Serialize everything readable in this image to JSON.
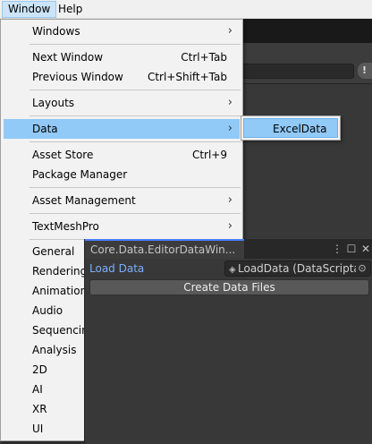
{
  "menubar": {
    "items": [
      "Window",
      "Help"
    ]
  },
  "window_menu": {
    "windows": {
      "label": "Windows",
      "arrow": "›"
    },
    "next_window": {
      "label": "Next Window",
      "shortcut": "Ctrl+Tab"
    },
    "previous_window": {
      "label": "Previous Window",
      "shortcut": "Ctrl+Shift+Tab"
    },
    "layouts": {
      "label": "Layouts",
      "arrow": "›"
    },
    "data": {
      "label": "Data",
      "arrow": "›"
    },
    "asset_store": {
      "label": "Asset Store",
      "shortcut": "Ctrl+9"
    },
    "package_manager": {
      "label": "Package Manager"
    },
    "asset_management": {
      "label": "Asset Management",
      "arrow": "›"
    },
    "textmeshpro": {
      "label": "TextMeshPro",
      "arrow": "›"
    },
    "general": "General",
    "rendering": "Rendering",
    "animation": "Animation",
    "audio": "Audio",
    "sequencing": "Sequencing",
    "analysis": "Analysis",
    "two_d": "2D",
    "ai": "AI",
    "xr": "XR",
    "ui": "UI"
  },
  "data_submenu": {
    "item": "ExcelData"
  },
  "editor_window": {
    "tab_title": "Core.Data.EditorDataWin...",
    "icons": {
      "more": "⋮",
      "maximize": "☐",
      "close": "✕"
    },
    "load_data_label": "Load Data",
    "object_field": "LoadData (DataScripta",
    "create_button": "Create Data Files"
  },
  "colors": {
    "menu_highlight": "#91c9f7",
    "panel_bg": "#383838",
    "label_blue": "#7bafff"
  }
}
